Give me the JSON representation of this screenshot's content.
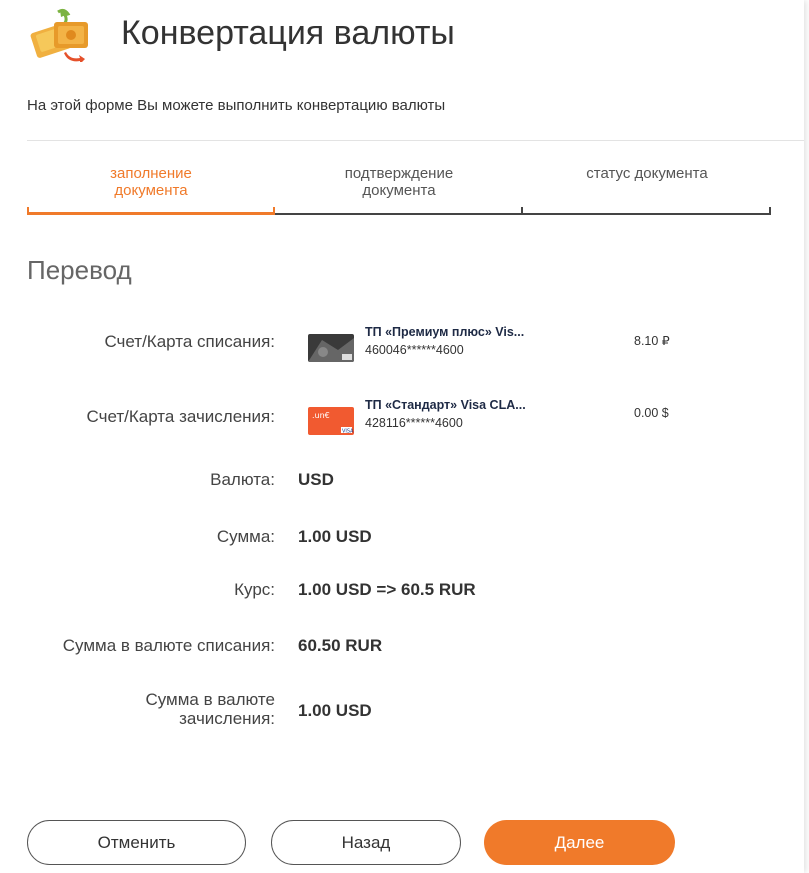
{
  "header": {
    "icon": "currency-exchange-icon",
    "title": "Конвертация валюты",
    "subtitle": "На этой форме Вы можете выполнить конвертацию валюты"
  },
  "steps": [
    {
      "line1": "заполнение",
      "line2": "документа",
      "active": true
    },
    {
      "line1": "подтверждение",
      "line2": "документа",
      "active": false
    },
    {
      "line1": "статус документа",
      "line2": "",
      "active": false
    }
  ],
  "section_title": "Перевод",
  "debit": {
    "label": "Счет/Карта списания:",
    "card_name": "ТП «Премиум плюс» Vis...",
    "card_number": "460046******4600",
    "balance": "8.10 ₽"
  },
  "credit": {
    "label": "Счет/Карта зачисления:",
    "card_name": "ТП «Стандарт» Visa CLA...",
    "card_number": "428116******4600",
    "balance": "0.00 $"
  },
  "fields": {
    "currency_label": "Валюта:",
    "currency_value": "USD",
    "amount_label": "Сумма:",
    "amount_value": "1.00 USD",
    "rate_label": "Курс:",
    "rate_value": "1.00 USD => 60.5 RUR",
    "debit_amount_label": "Сумма в валюте списания:",
    "debit_amount_value": "60.50 RUR",
    "credit_amount_label_line1": "Сумма в валюте",
    "credit_amount_label_line2": "зачисления:",
    "credit_amount_value": "1.00 USD"
  },
  "buttons": {
    "cancel": "Отменить",
    "back": "Назад",
    "next": "Далее"
  },
  "colors": {
    "accent": "#f07a2a",
    "text": "#333333"
  }
}
